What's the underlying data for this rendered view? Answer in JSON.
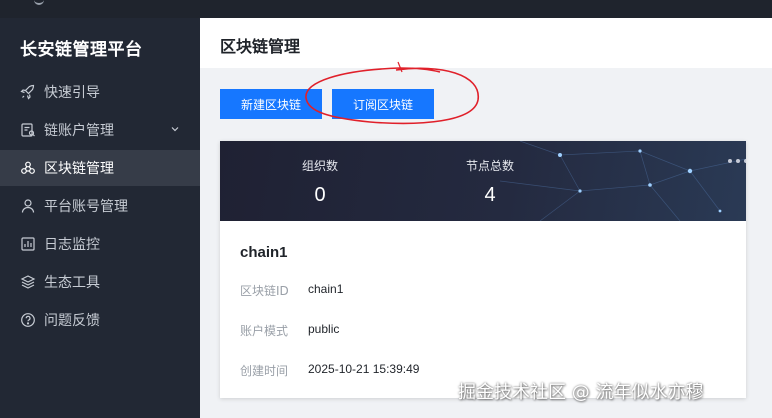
{
  "sidebar": {
    "brand": "长安链管理平台",
    "items": [
      {
        "label": "快速引导",
        "icon": "rocket-icon"
      },
      {
        "label": "链账户管理",
        "icon": "account-icon",
        "has_submenu": true
      },
      {
        "label": "区块链管理",
        "icon": "blockchain-icon",
        "active": true
      },
      {
        "label": "平台账号管理",
        "icon": "user-icon"
      },
      {
        "label": "日志监控",
        "icon": "chart-icon"
      },
      {
        "label": "生态工具",
        "icon": "layers-icon"
      },
      {
        "label": "问题反馈",
        "icon": "question-icon"
      }
    ]
  },
  "header": {
    "title": "区块链管理"
  },
  "toolbar": {
    "new_label": "新建区块链",
    "subscribe_label": "订阅区块链"
  },
  "card": {
    "stats": {
      "org_label": "组织数",
      "org_value": "0",
      "node_label": "节点总数",
      "node_value": "4"
    },
    "name": "chain1",
    "fields": [
      {
        "label": "区块链ID",
        "value": "chain1"
      },
      {
        "label": "账户模式",
        "value": "public"
      },
      {
        "label": "创建时间",
        "value": "2025-10-21 15:39:49"
      }
    ]
  },
  "watermark": "掘金技术社区 @ 流年似水亦穆",
  "colors": {
    "sidebar_bg": "#222834",
    "active_item_bg": "#363c48",
    "primary": "#1677ff",
    "annotation": "#e0202a"
  }
}
